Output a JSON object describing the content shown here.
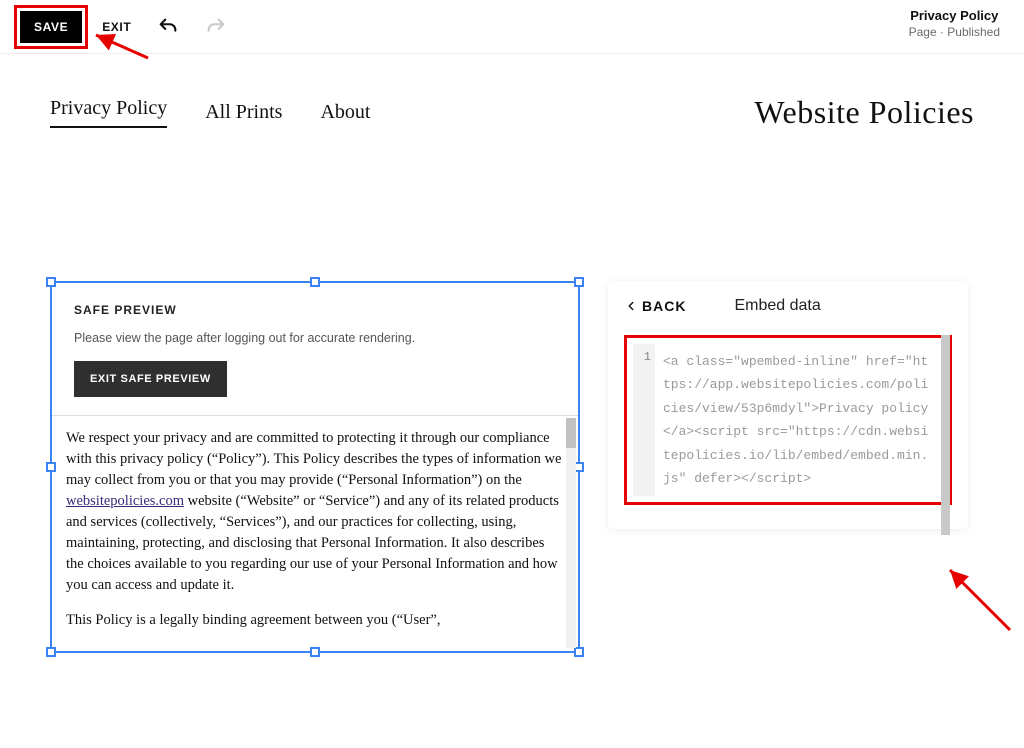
{
  "topbar": {
    "save_label": "SAVE",
    "exit_label": "EXIT",
    "status_title": "Privacy Policy",
    "status_sub": "Page · Published"
  },
  "nav": {
    "items": [
      "Privacy Policy",
      "All Prints",
      "About"
    ],
    "brand": "Website Policies"
  },
  "safe_preview": {
    "title": "SAFE PREVIEW",
    "message": "Please view the page after logging out for accurate rendering.",
    "exit_label": "EXIT SAFE PREVIEW"
  },
  "policy": {
    "p1a": "We respect your privacy and are committed to protecting it through our compliance with this privacy policy (“Policy”). This Policy describes the types of information we may collect from you or that you may provide (“Personal Information”) on the ",
    "link_text": "websitepolicies.com",
    "p1b": " website (“Website” or “Service”) and any of its related products and services (collectively, “Services”), and our practices for collecting, using, maintaining, protecting, and disclosing that Personal Information. It also describes the choices available to you regarding our use of your Personal Information and how you can access and update it.",
    "p2": "This Policy is a legally binding agreement between you (“User”,"
  },
  "panel": {
    "back_label": "BACK",
    "title": "Embed data",
    "gutter": "1",
    "code": "<a class=\"wpembed-inline\" href=\"https://app.websitepolicies.com/policies/view/53p6mdyl\">Privacy policy</a><script src=\"https://cdn.websitepolicies.io/lib/embed/embed.min.js\" defer></script>"
  }
}
